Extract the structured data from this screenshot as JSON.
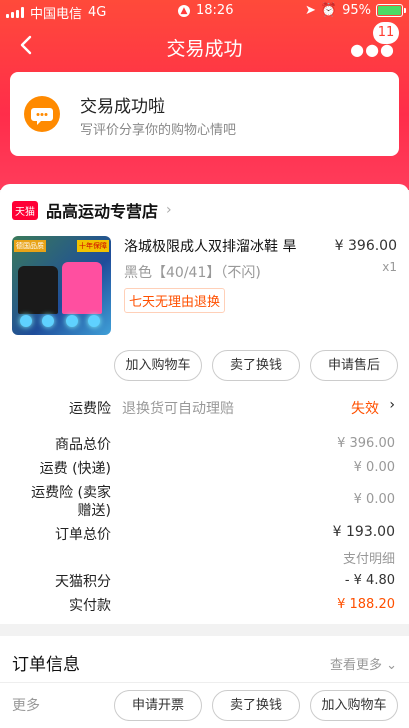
{
  "status_bar": {
    "carrier": "中国电信",
    "network": "4G",
    "time": "18:26",
    "battery": "95%"
  },
  "nav": {
    "title": "交易成功",
    "badge": "11"
  },
  "success": {
    "heading": "交易成功啦",
    "subtext": "写评价分享你的购物心情吧"
  },
  "shop": {
    "tag": "天猫",
    "name": "品高运动专营店"
  },
  "product": {
    "name": "洛城极限成人双排溜冰鞋 旱",
    "sku": "黑色【40/41】（不闪)",
    "tag": "七天无理由退换",
    "price": "¥ 396.00",
    "qty": "x1",
    "thumb_tag_left": "德国品质",
    "thumb_tag_right": "十年保障"
  },
  "item_buttons": [
    "加入购物车",
    "卖了换钱",
    "申请售后"
  ],
  "insurance": {
    "label": "运费险",
    "desc": "退换货可自动理赔",
    "status": "失效"
  },
  "summary": [
    {
      "label": "商品总价",
      "value": "¥ 396.00"
    },
    {
      "label": "运费 (快递)",
      "value": "¥ 0.00"
    },
    {
      "label": "运费险 (卖家",
      "label2": "赠送)",
      "value": "¥ 0.00"
    },
    {
      "label": "订单总价",
      "value": "¥ 193.00"
    },
    {
      "label": "",
      "value": "支付明细"
    },
    {
      "label": "天猫积分",
      "value": "- ¥ 4.80"
    },
    {
      "label": "实付款",
      "value": "¥ 188.20"
    }
  ],
  "order_info": {
    "title": "订单信息",
    "more": "查看更多"
  },
  "bottom_bar": {
    "more": "更多",
    "buttons": [
      "申请开票",
      "卖了换钱",
      "加入购物车"
    ]
  },
  "colors": {
    "brand_red": "#ff2d4a",
    "accent_orange": "#ff5000",
    "icon_orange": "#ff8a00"
  }
}
